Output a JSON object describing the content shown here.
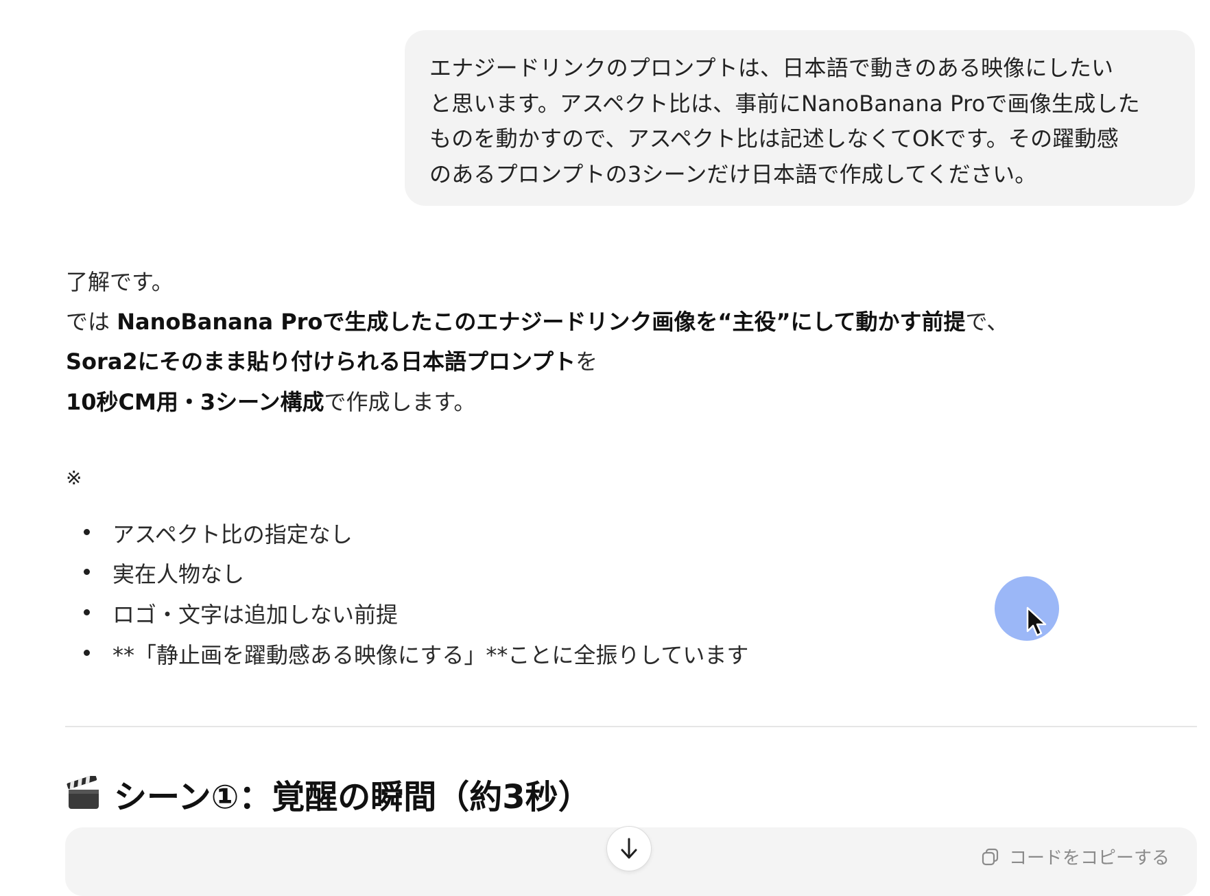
{
  "user_message": {
    "lines": [
      "エナジードリンクのプロンプトは、日本語で動きのある映像にしたい",
      "と思います。アスペクト比は、事前にNanoBanana Proで画像生成した",
      "ものを動かすので、アスペクト比は記述しなくてOKです。その躍動感",
      "のあるプロンプトの3シーンだけ日本語で作成してください。"
    ]
  },
  "assistant": {
    "line1": "了解です。",
    "line2_a": "では ",
    "line2_b": "NanoBanana Proで生成したこのエナジードリンク画像を“主役”にして動かす前提",
    "line2_c": "で、",
    "line3_b": "Sora2にそのまま貼り付けられる日本語プロンプト",
    "line3_c": "を",
    "line4_b": "10秒CM用・3シーン構成",
    "line4_c": "で作成します。",
    "note_mark": "※",
    "bullets": [
      "アスペクト比の指定なし",
      "実在人物なし",
      "ロゴ・文字は追加しない前提",
      "**「静止画を躍動感ある映像にする」**ことに全振りしています"
    ],
    "heading": "シーン①：覚醒の瞬間（約3秒）",
    "heading_icon": "clapperboard-icon"
  },
  "code_block": {
    "copy_label": "コードをコピーする",
    "copy_icon": "copy-icon"
  },
  "scroll_button_icon": "arrow-down-icon",
  "colors": {
    "bubble_bg": "#f3f3f3",
    "code_bg": "#f4f4f4",
    "cursor_halo": "#8aaaf6",
    "divider": "#e5e5e5"
  }
}
